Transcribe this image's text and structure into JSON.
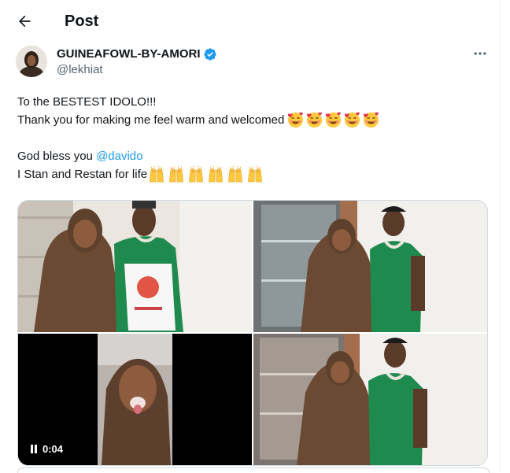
{
  "header": {
    "title": "Post",
    "back_icon": "arrow-left-icon"
  },
  "author": {
    "display_name": "GUINEAFOWL-BY-AMORI",
    "handle": "@lekhiat",
    "verified_icon": "verified-badge-icon",
    "verified_color": "#1d9bf0"
  },
  "more_icon": "more-horizontal-icon",
  "tweet": {
    "line1": "To the BESTEST IDOLO!!!",
    "line2": "Thank you for making me feel warm and welcomed",
    "line2_emoji": "smiling-face-with-hearts-emoji",
    "line2_emoji_count": 5,
    "line3_prefix": "God bless you ",
    "line3_mention": "@davido",
    "line4": "I Stan and Restan for life",
    "line4_emoji": "raising-hands-emoji",
    "line4_emoji_count": 6
  },
  "media": {
    "items": [
      {
        "kind": "photo",
        "description_icon": "photo-woman-man-with-gift-bag"
      },
      {
        "kind": "photo",
        "description_icon": "photo-woman-man-posing"
      },
      {
        "kind": "video",
        "duration": "0:04",
        "play_icon": "pause-icon"
      },
      {
        "kind": "photo",
        "description_icon": "photo-woman-man-posing-2"
      }
    ]
  },
  "colors": {
    "text": "#0f1419",
    "secondary": "#536471",
    "link": "#1d9bf0",
    "border": "#cfd9de"
  }
}
